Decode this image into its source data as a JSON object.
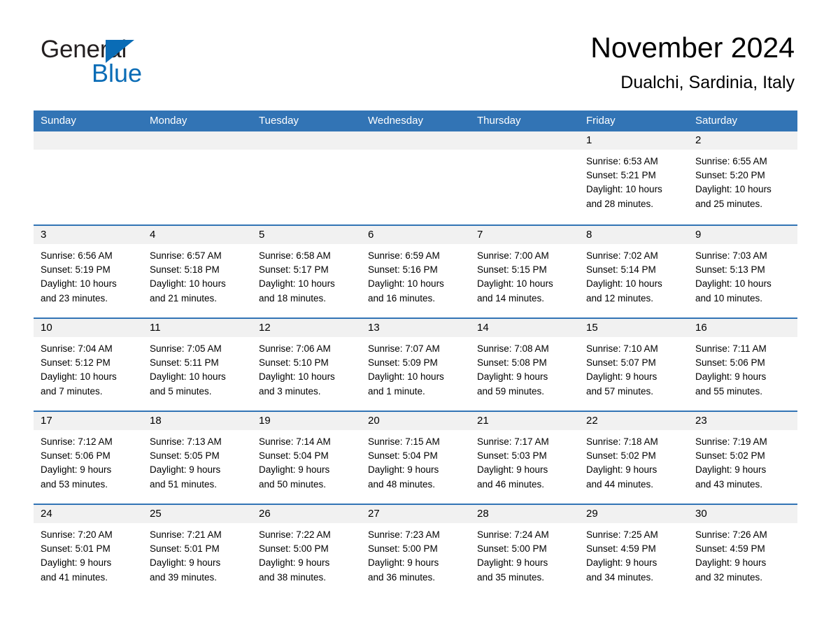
{
  "brand": {
    "logo_primary": "General",
    "logo_secondary": "Blue",
    "triangle_icon": "triangle-icon",
    "accent_color": "#0a6cb6"
  },
  "header": {
    "title": "November 2024",
    "subtitle": "Dualchi, Sardinia, Italy"
  },
  "calendar": {
    "header_color": "#3274b5",
    "date_band_color": "#f1f1f1",
    "weekday_headers": [
      "Sunday",
      "Monday",
      "Tuesday",
      "Wednesday",
      "Thursday",
      "Friday",
      "Saturday"
    ],
    "weeks": [
      [
        {
          "date": "",
          "lines": []
        },
        {
          "date": "",
          "lines": []
        },
        {
          "date": "",
          "lines": []
        },
        {
          "date": "",
          "lines": []
        },
        {
          "date": "",
          "lines": []
        },
        {
          "date": "1",
          "lines": [
            "Sunrise: 6:53 AM",
            "Sunset: 5:21 PM",
            "Daylight: 10 hours",
            "and 28 minutes."
          ]
        },
        {
          "date": "2",
          "lines": [
            "Sunrise: 6:55 AM",
            "Sunset: 5:20 PM",
            "Daylight: 10 hours",
            "and 25 minutes."
          ]
        }
      ],
      [
        {
          "date": "3",
          "lines": [
            "Sunrise: 6:56 AM",
            "Sunset: 5:19 PM",
            "Daylight: 10 hours",
            "and 23 minutes."
          ]
        },
        {
          "date": "4",
          "lines": [
            "Sunrise: 6:57 AM",
            "Sunset: 5:18 PM",
            "Daylight: 10 hours",
            "and 21 minutes."
          ]
        },
        {
          "date": "5",
          "lines": [
            "Sunrise: 6:58 AM",
            "Sunset: 5:17 PM",
            "Daylight: 10 hours",
            "and 18 minutes."
          ]
        },
        {
          "date": "6",
          "lines": [
            "Sunrise: 6:59 AM",
            "Sunset: 5:16 PM",
            "Daylight: 10 hours",
            "and 16 minutes."
          ]
        },
        {
          "date": "7",
          "lines": [
            "Sunrise: 7:00 AM",
            "Sunset: 5:15 PM",
            "Daylight: 10 hours",
            "and 14 minutes."
          ]
        },
        {
          "date": "8",
          "lines": [
            "Sunrise: 7:02 AM",
            "Sunset: 5:14 PM",
            "Daylight: 10 hours",
            "and 12 minutes."
          ]
        },
        {
          "date": "9",
          "lines": [
            "Sunrise: 7:03 AM",
            "Sunset: 5:13 PM",
            "Daylight: 10 hours",
            "and 10 minutes."
          ]
        }
      ],
      [
        {
          "date": "10",
          "lines": [
            "Sunrise: 7:04 AM",
            "Sunset: 5:12 PM",
            "Daylight: 10 hours",
            "and 7 minutes."
          ]
        },
        {
          "date": "11",
          "lines": [
            "Sunrise: 7:05 AM",
            "Sunset: 5:11 PM",
            "Daylight: 10 hours",
            "and 5 minutes."
          ]
        },
        {
          "date": "12",
          "lines": [
            "Sunrise: 7:06 AM",
            "Sunset: 5:10 PM",
            "Daylight: 10 hours",
            "and 3 minutes."
          ]
        },
        {
          "date": "13",
          "lines": [
            "Sunrise: 7:07 AM",
            "Sunset: 5:09 PM",
            "Daylight: 10 hours",
            "and 1 minute."
          ]
        },
        {
          "date": "14",
          "lines": [
            "Sunrise: 7:08 AM",
            "Sunset: 5:08 PM",
            "Daylight: 9 hours",
            "and 59 minutes."
          ]
        },
        {
          "date": "15",
          "lines": [
            "Sunrise: 7:10 AM",
            "Sunset: 5:07 PM",
            "Daylight: 9 hours",
            "and 57 minutes."
          ]
        },
        {
          "date": "16",
          "lines": [
            "Sunrise: 7:11 AM",
            "Sunset: 5:06 PM",
            "Daylight: 9 hours",
            "and 55 minutes."
          ]
        }
      ],
      [
        {
          "date": "17",
          "lines": [
            "Sunrise: 7:12 AM",
            "Sunset: 5:06 PM",
            "Daylight: 9 hours",
            "and 53 minutes."
          ]
        },
        {
          "date": "18",
          "lines": [
            "Sunrise: 7:13 AM",
            "Sunset: 5:05 PM",
            "Daylight: 9 hours",
            "and 51 minutes."
          ]
        },
        {
          "date": "19",
          "lines": [
            "Sunrise: 7:14 AM",
            "Sunset: 5:04 PM",
            "Daylight: 9 hours",
            "and 50 minutes."
          ]
        },
        {
          "date": "20",
          "lines": [
            "Sunrise: 7:15 AM",
            "Sunset: 5:04 PM",
            "Daylight: 9 hours",
            "and 48 minutes."
          ]
        },
        {
          "date": "21",
          "lines": [
            "Sunrise: 7:17 AM",
            "Sunset: 5:03 PM",
            "Daylight: 9 hours",
            "and 46 minutes."
          ]
        },
        {
          "date": "22",
          "lines": [
            "Sunrise: 7:18 AM",
            "Sunset: 5:02 PM",
            "Daylight: 9 hours",
            "and 44 minutes."
          ]
        },
        {
          "date": "23",
          "lines": [
            "Sunrise: 7:19 AM",
            "Sunset: 5:02 PM",
            "Daylight: 9 hours",
            "and 43 minutes."
          ]
        }
      ],
      [
        {
          "date": "24",
          "lines": [
            "Sunrise: 7:20 AM",
            "Sunset: 5:01 PM",
            "Daylight: 9 hours",
            "and 41 minutes."
          ]
        },
        {
          "date": "25",
          "lines": [
            "Sunrise: 7:21 AM",
            "Sunset: 5:01 PM",
            "Daylight: 9 hours",
            "and 39 minutes."
          ]
        },
        {
          "date": "26",
          "lines": [
            "Sunrise: 7:22 AM",
            "Sunset: 5:00 PM",
            "Daylight: 9 hours",
            "and 38 minutes."
          ]
        },
        {
          "date": "27",
          "lines": [
            "Sunrise: 7:23 AM",
            "Sunset: 5:00 PM",
            "Daylight: 9 hours",
            "and 36 minutes."
          ]
        },
        {
          "date": "28",
          "lines": [
            "Sunrise: 7:24 AM",
            "Sunset: 5:00 PM",
            "Daylight: 9 hours",
            "and 35 minutes."
          ]
        },
        {
          "date": "29",
          "lines": [
            "Sunrise: 7:25 AM",
            "Sunset: 4:59 PM",
            "Daylight: 9 hours",
            "and 34 minutes."
          ]
        },
        {
          "date": "30",
          "lines": [
            "Sunrise: 7:26 AM",
            "Sunset: 4:59 PM",
            "Daylight: 9 hours",
            "and 32 minutes."
          ]
        }
      ]
    ]
  }
}
